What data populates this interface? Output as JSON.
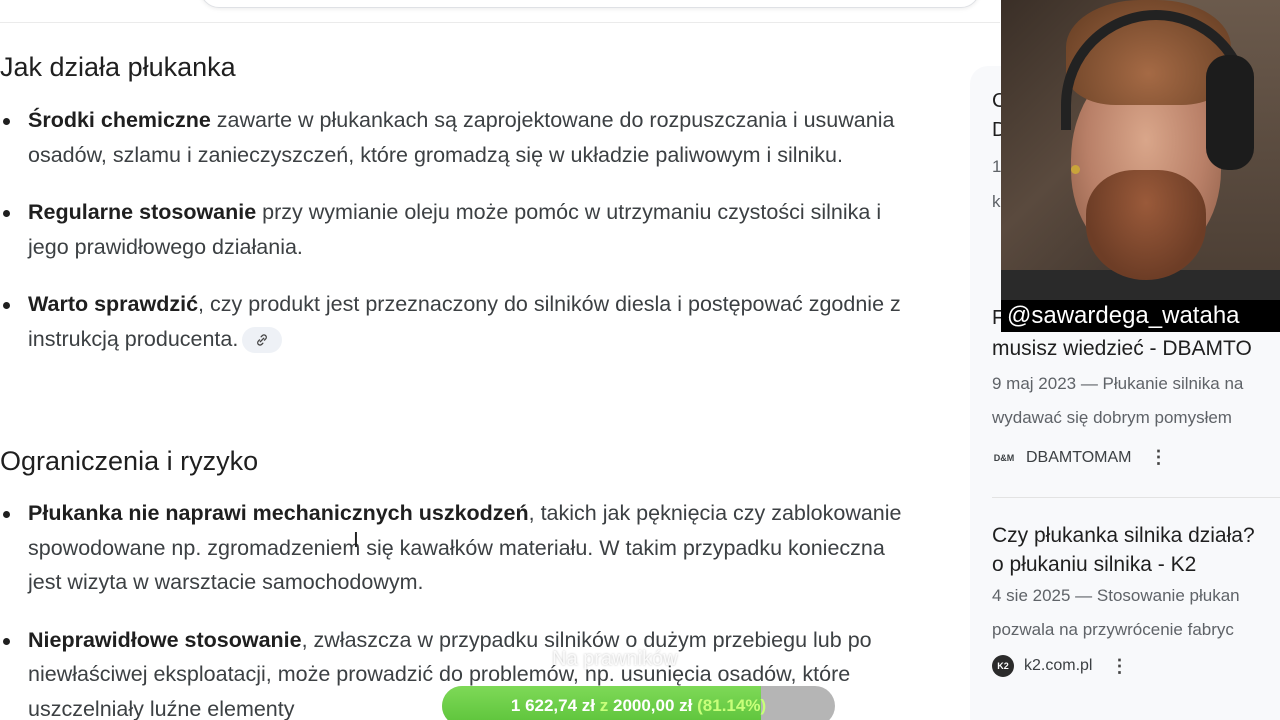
{
  "sections": [
    {
      "heading": "Jak działa płukanka",
      "items": [
        {
          "bold": "Środki chemiczne",
          "text": " zawarte w płukankach są zaprojektowane do rozpuszczania i usuwania osadów, szlamu i zanieczyszczeń, które gromadzą się w układzie paliwowym i silniku."
        },
        {
          "bold": "Regularne stosowanie",
          "text": " przy wymianie oleju może pomóc w utrzymaniu czystości silnika i jego prawidłowego działania."
        },
        {
          "bold": "Warto sprawdzić",
          "text": ", czy produkt jest przeznaczony do silników diesla i postępować zgodnie z instrukcją producenta."
        }
      ]
    },
    {
      "heading": "Ograniczenia i ryzyko",
      "items": [
        {
          "bold": "Płukanka nie naprawi mechanicznych uszkodzeń",
          "text": ", takich jak pęknięcia czy zablokowanie spowodowane np. zgromadzeniem się kawałków materiału. W takim przypadku konieczna jest wizyta w warsztacie samochodowym."
        },
        {
          "bold": "Nieprawidłowe stosowanie",
          "text": ", zwłaszcza w przypadku silników o dużym przebiegu lub po niewłaściwej eksploatacji, może prowadzić do problemów, np. usunięcia osadów, które uszczelniały luźne elementy"
        }
      ]
    }
  ],
  "sidebar": {
    "partial_letters": {
      "a": "C",
      "b": "D",
      "c": "1",
      "d": "k",
      "e": "F"
    },
    "card1": {
      "title_line2": "musisz wiedzieć - DBAMTO",
      "snippet_line1": "9 maj 2023 — Płukanie silnika na",
      "snippet_line2": "wydawać się dobrym pomysłem",
      "source": "DBAMTOMAM",
      "logo_text": "D&M"
    },
    "card2": {
      "title_line1": "Czy płukanka silnika działa?",
      "title_line2": "o płukaniu silnika - K2",
      "snippet_line1": "4 sie 2025 — Stosowanie płukan",
      "snippet_line2": "pozwala na przywrócenie fabryc",
      "source": "k2.com.pl",
      "logo_text": "K2"
    }
  },
  "overlay": {
    "handle": "@sawardega_wataha",
    "faint_text": "Na prawników",
    "goal": {
      "current": "1 622,74 zł",
      "separator": "z",
      "target": "2000,00 zł",
      "percent_label": "(81.14%)",
      "fraction": 0.8114
    }
  },
  "colors": {
    "progress_green": "#5cc33a",
    "progress_track": "#b5b5b5"
  }
}
